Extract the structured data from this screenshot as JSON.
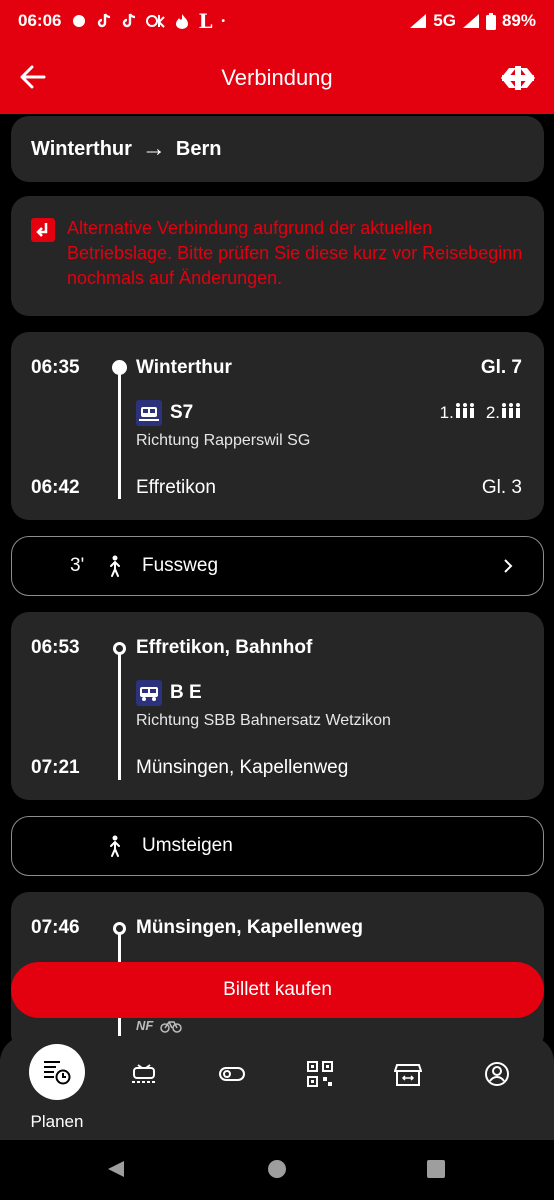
{
  "status_bar": {
    "time": "06:06",
    "network": "5G",
    "battery": "89%"
  },
  "header": {
    "title": "Verbindung"
  },
  "route": {
    "from": "Winterthur",
    "arrow": "→",
    "to": "Bern"
  },
  "alert": {
    "text": "Alternative Verbindung aufgrund der aktuellen Betriebslage. Bitte prüfen Sie diese kurz vor Reisebeginn nochmals auf Änderungen."
  },
  "legs": [
    {
      "dep_time": "06:35",
      "dep_station": "Winterthur",
      "dep_track": "Gl. 7",
      "line": "S7",
      "direction": "Richtung Rapperswil SG",
      "occupancy_1": "1.",
      "occupancy_2": "2.",
      "arr_time": "06:42",
      "arr_station": "Effretikon",
      "arr_track": "Gl. 3"
    },
    {
      "dep_time": "06:53",
      "dep_station": "Effretikon, Bahnhof",
      "line": "B E",
      "direction": "Richtung SBB Bahnersatz Wetzikon",
      "arr_time": "07:21",
      "arr_station": "Münsingen, Kapellenweg"
    },
    {
      "dep_time": "07:46",
      "dep_station": "Münsingen, Kapellenweg",
      "note": "NF"
    }
  ],
  "walk": {
    "duration": "3'",
    "label": "Fussweg"
  },
  "transfer": {
    "label": "Umsteigen"
  },
  "buy_button": "Billett kaufen",
  "bottom_nav": {
    "active_label": "Planen",
    "items": [
      "planen-icon",
      "timetable-icon",
      "toggle-icon",
      "qr-icon",
      "shop-icon",
      "profile-icon"
    ]
  },
  "colors": {
    "brand_red": "#e3000f",
    "card": "#262626",
    "vehicle_blue": "#2d327d"
  }
}
